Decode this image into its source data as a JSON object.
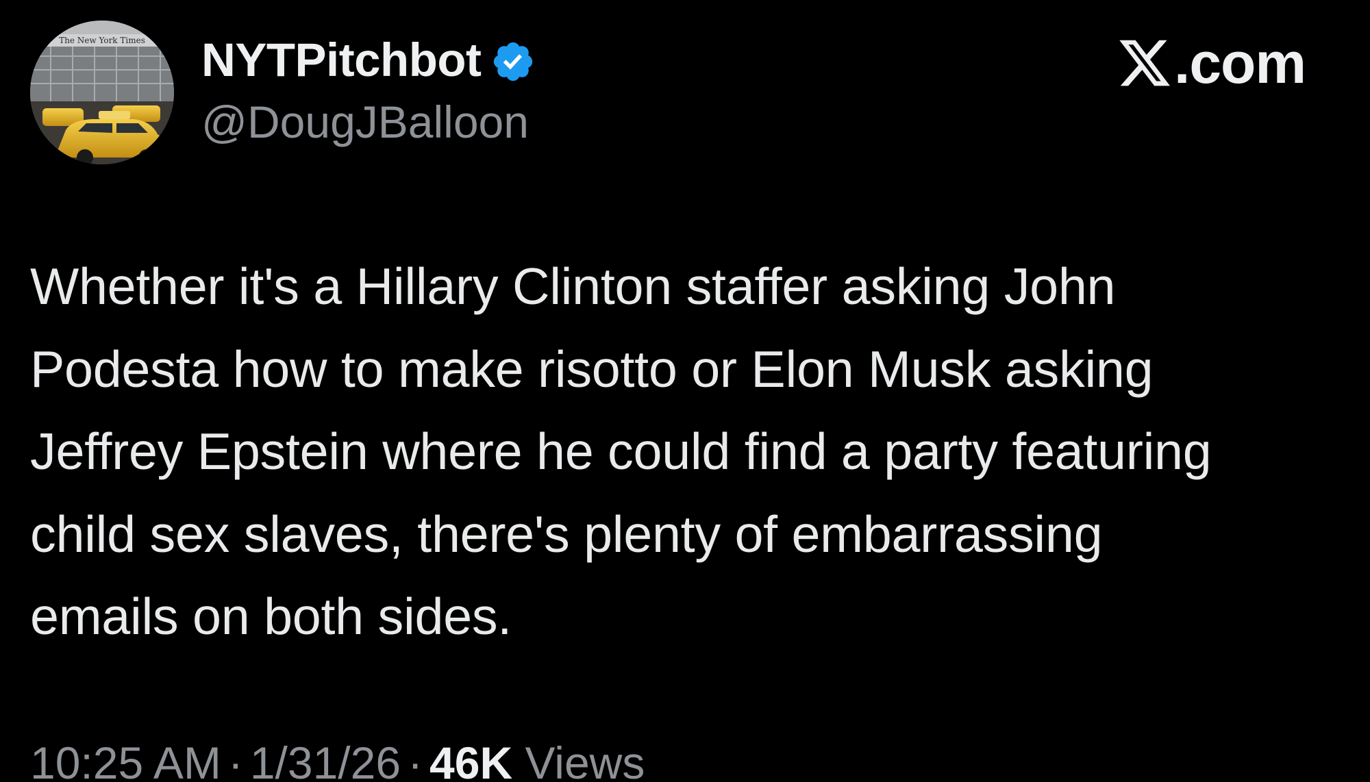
{
  "author": {
    "display_name": "NYTPitchbot",
    "handle": "@DougJBalloon",
    "verified_icon": "verified-badge-icon",
    "avatar_alt": "The New York Times building with yellow taxi",
    "avatar_sign_text": "The New York Times"
  },
  "brand": {
    "logo_icon": "x-logo-icon",
    "label": ".com"
  },
  "tweet": {
    "lines": [
      "Whether it's a Hillary Clinton staffer asking John",
      "Podesta how to make risotto or Elon Musk asking",
      "Jeffrey Epstein where he could find a party featuring",
      "child sex slaves, there's plenty of embarrassing",
      "emails on both sides."
    ]
  },
  "meta": {
    "time": "10:25 AM",
    "separator": "·",
    "date": "1/31/26",
    "views_count": "46K",
    "views_label": "Views"
  },
  "colors": {
    "background": "#000000",
    "text_primary": "#e7e9ea",
    "text_secondary": "#8e9297",
    "verified_blue": "#1d9bf0",
    "taxi_yellow": "#f2c028"
  }
}
